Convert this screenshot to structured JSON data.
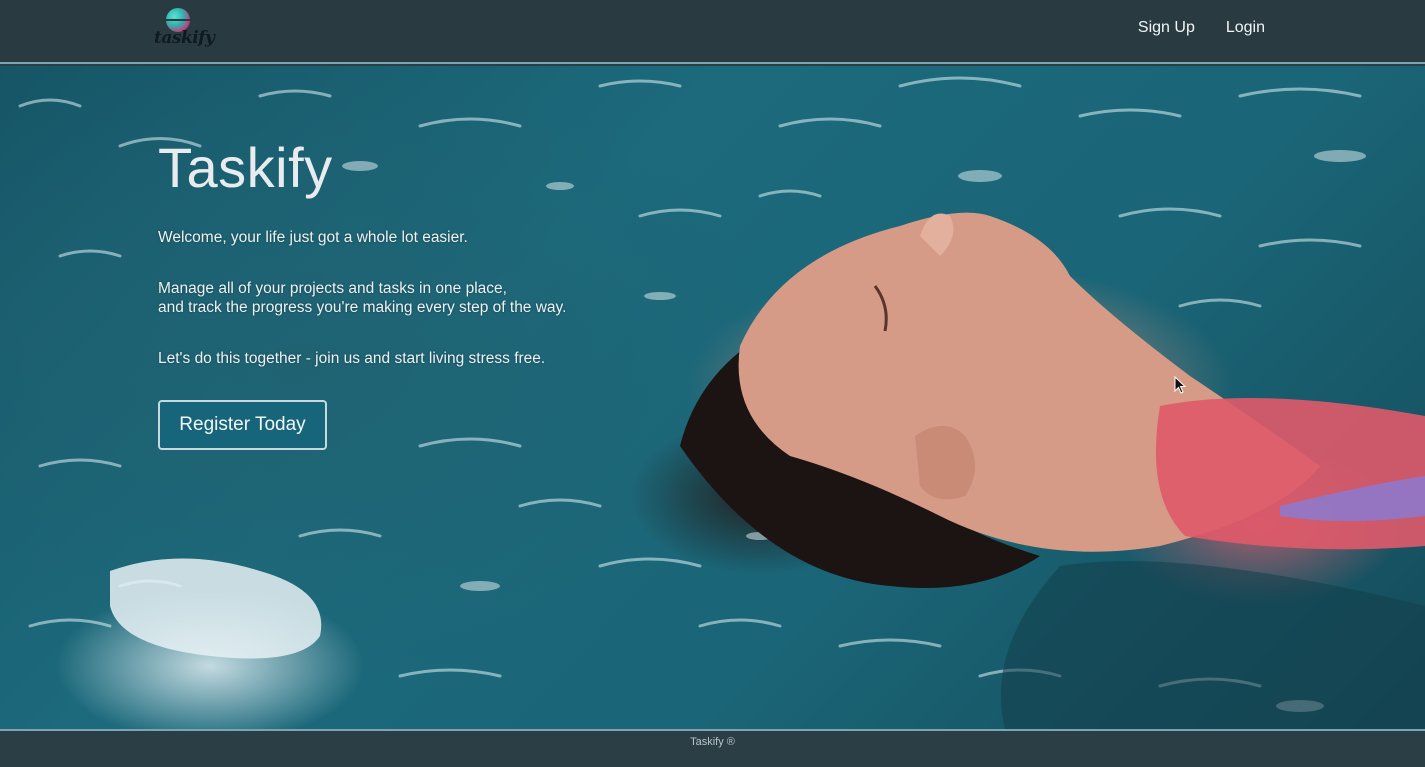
{
  "brand": {
    "logo_text": "taskify",
    "colors": {
      "nav_bg": "#2a3a41",
      "accent_border": "#7aa6b3",
      "button_bg": "#17657a"
    }
  },
  "nav": {
    "links": [
      {
        "label": "Sign Up"
      },
      {
        "label": "Login"
      }
    ]
  },
  "hero": {
    "title": "Taskify",
    "paragraphs": [
      "Welcome, your life just got a whole lot easier.",
      "Manage all of your projects and tasks in one place,",
      "and track the progress you're making every step of the way.",
      "Let's do this together - join us and start living stress free."
    ],
    "cta_label": "Register Today",
    "background_image": "woman-floating-in-pool"
  },
  "footer": {
    "text": "Taskify ®"
  }
}
